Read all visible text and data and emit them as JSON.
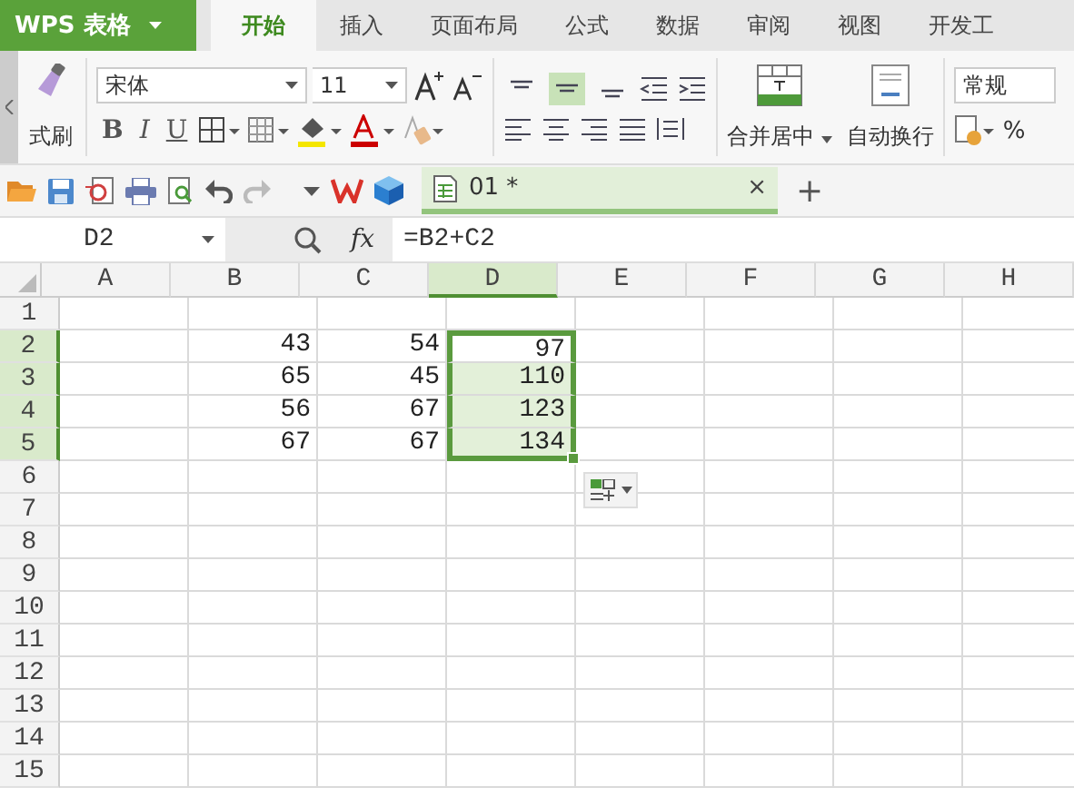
{
  "app_button": {
    "label": "WPS 表格"
  },
  "ribbon_tabs": [
    {
      "label": "开始",
      "selected": true
    },
    {
      "label": "插入",
      "selected": false
    },
    {
      "label": "页面布局",
      "selected": false
    },
    {
      "label": "公式",
      "selected": false
    },
    {
      "label": "数据",
      "selected": false
    },
    {
      "label": "审阅",
      "selected": false
    },
    {
      "label": "视图",
      "selected": false
    },
    {
      "label": "开发工",
      "selected": false
    }
  ],
  "ribbon": {
    "format_painter": "式刷",
    "font": "宋体",
    "font_size": "11",
    "bold": "B",
    "italic": "I",
    "underline": "U",
    "vertical_align": [
      {
        "selected": false
      },
      {
        "selected": true
      },
      {
        "selected": false
      }
    ],
    "merge": "合并居中",
    "wrap": "自动换行",
    "number_format": "常规",
    "percent": "%"
  },
  "document_tab": {
    "title": "01 *",
    "close": "×",
    "new": "+"
  },
  "formula_bar": {
    "name_box": "D2",
    "fx": "fx",
    "formula": "=B2+C2"
  },
  "columns": [
    {
      "label": "A",
      "selected": false
    },
    {
      "label": "B",
      "selected": false
    },
    {
      "label": "C",
      "selected": false
    },
    {
      "label": "D",
      "selected": true
    },
    {
      "label": "E",
      "selected": false
    },
    {
      "label": "F",
      "selected": false
    },
    {
      "label": "G",
      "selected": false
    },
    {
      "label": "H",
      "selected": false
    }
  ],
  "rows": [
    {
      "label": "1",
      "selected": false
    },
    {
      "label": "2",
      "selected": true,
      "cells": {
        "B": {
          "text": "43",
          "active": false
        },
        "C": {
          "text": "54",
          "active": false
        },
        "D": {
          "text": "97",
          "active": true
        }
      }
    },
    {
      "label": "3",
      "selected": true,
      "cells": {
        "B": {
          "text": "65",
          "active": false
        },
        "C": {
          "text": "45",
          "active": false
        },
        "D": {
          "text": "110",
          "active": false
        }
      }
    },
    {
      "label": "4",
      "selected": true,
      "cells": {
        "B": {
          "text": "56",
          "active": false
        },
        "C": {
          "text": "67",
          "active": false
        },
        "D": {
          "text": "123",
          "active": false
        }
      }
    },
    {
      "label": "5",
      "selected": true,
      "cells": {
        "B": {
          "text": "67",
          "active": false
        },
        "C": {
          "text": "67",
          "active": false
        },
        "D": {
          "text": "134",
          "active": false
        }
      }
    },
    {
      "label": "6",
      "selected": false
    },
    {
      "label": "7",
      "selected": false
    },
    {
      "label": "8",
      "selected": false
    },
    {
      "label": "9",
      "selected": false
    },
    {
      "label": "10",
      "selected": false
    },
    {
      "label": "11",
      "selected": false
    },
    {
      "label": "12",
      "selected": false
    },
    {
      "label": "13",
      "selected": false
    },
    {
      "label": "14",
      "selected": false
    },
    {
      "label": "15",
      "selected": false
    }
  ]
}
